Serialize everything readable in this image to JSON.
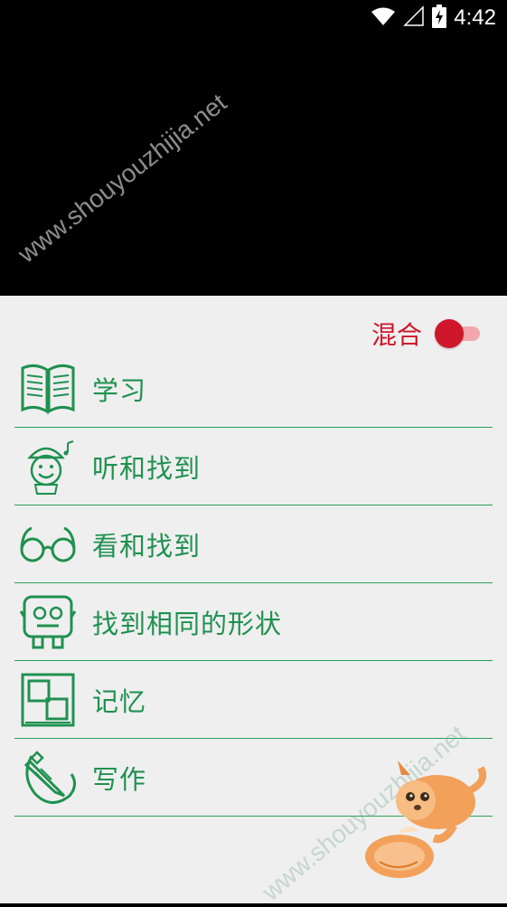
{
  "status_bar": {
    "time": "4:42",
    "icons": [
      "wifi-icon",
      "signal-icon",
      "battery-charging-icon"
    ]
  },
  "settings": {
    "mix_label": "混合",
    "mix_toggle_on": true
  },
  "menu": {
    "items": [
      {
        "label": "学习",
        "icon": "book-icon"
      },
      {
        "label": "听和找到",
        "icon": "listening-kid-icon"
      },
      {
        "label": "看和找到",
        "icon": "glasses-icon"
      },
      {
        "label": "找到相同的形状",
        "icon": "shapes-face-icon"
      },
      {
        "label": "记忆",
        "icon": "memory-cards-icon"
      },
      {
        "label": "写作",
        "icon": "pencil-icon"
      }
    ]
  },
  "watermark": {
    "text": "www.shouyouzhijia.net"
  },
  "colors": {
    "accent_green": "#1f9150",
    "divider_green": "#2aa058",
    "toggle_red": "#d0162a",
    "panel_bg": "#efefef"
  }
}
